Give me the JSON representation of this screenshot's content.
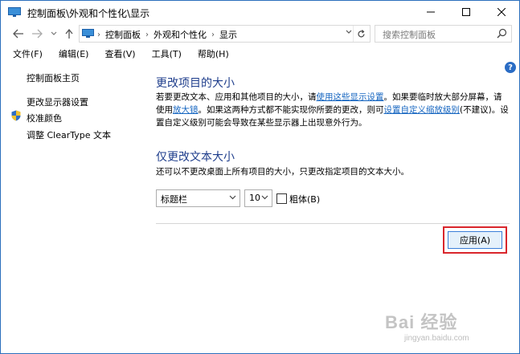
{
  "window": {
    "title": "控制面板\\外观和个性化\\显示"
  },
  "nav": {
    "breadcrumbs": [
      "控制面板",
      "外观和个性化",
      "显示"
    ],
    "search_placeholder": "搜索控制面板"
  },
  "menu": {
    "items": [
      "文件(F)",
      "编辑(E)",
      "查看(V)",
      "工具(T)",
      "帮助(H)"
    ]
  },
  "sidebar": {
    "items": [
      "控制面板主页",
      "更改显示器设置",
      "校准颜色",
      "调整 ClearType 文本"
    ]
  },
  "section1": {
    "heading": "更改项目的大小",
    "text_a": "若要更改文本、应用和其他项目的大小，请",
    "link_a": "使用这些显示设置",
    "text_b": "。如果要临时放大部分屏幕，请使用",
    "link_b": "放大镜",
    "text_c": "。如果这两种方式都不能实现你所要的更改，则可",
    "link_c": "设置自定义缩放级别",
    "text_d": "(不建议)。设置自定义级别可能会导致在某些显示器上出现意外行为。"
  },
  "section2": {
    "heading": "仅更改文本大小",
    "description": "还可以不更改桌面上所有项目的大小，只更改指定项目的文本大小。",
    "item_select_value": "标题栏",
    "size_select_value": "10",
    "bold_label": "粗体(B)",
    "bold_checked": false
  },
  "footer": {
    "apply_label": "应用(A)"
  },
  "watermark": {
    "logo": "Bai 经验",
    "sub": "jingyan.baidu.com"
  },
  "colors": {
    "heading": "#1f3e8c",
    "link": "#1565c0",
    "highlight_frame": "#d9262c",
    "help_icon": "#2a6cc4"
  }
}
